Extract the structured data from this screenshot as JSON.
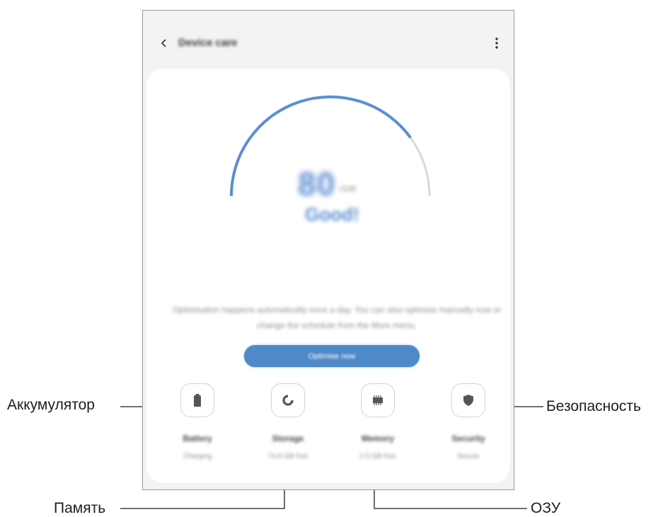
{
  "appbar": {
    "title": "Device care",
    "back_icon": "chevron-left-icon",
    "more_icon": "more-vertical-icon"
  },
  "score": {
    "value": "80",
    "unit": "/100",
    "status": "Good!",
    "gauge_fraction": 0.8,
    "gauge_color": "#5b8fd0",
    "gauge_track_color": "#d9d9d9"
  },
  "description": "Optimisation happens automatically once a day. You can also optimise manually now or change the schedule from the More menu.",
  "optimise_button": {
    "label": "Optimise now",
    "color": "#4f89c8"
  },
  "items": [
    {
      "label": "Battery",
      "sub": "Charging",
      "icon": "battery-icon"
    },
    {
      "label": "Storage",
      "sub": "74.9 GB free",
      "icon": "storage-pie-icon"
    },
    {
      "label": "Memory",
      "sub": "2.5 GB free",
      "icon": "memory-chip-icon"
    },
    {
      "label": "Security",
      "sub": "Secure",
      "icon": "shield-icon"
    }
  ],
  "annotations": {
    "battery": "Аккумулятор",
    "storage": "Память",
    "memory": "ОЗУ",
    "security": "Безопасность"
  }
}
